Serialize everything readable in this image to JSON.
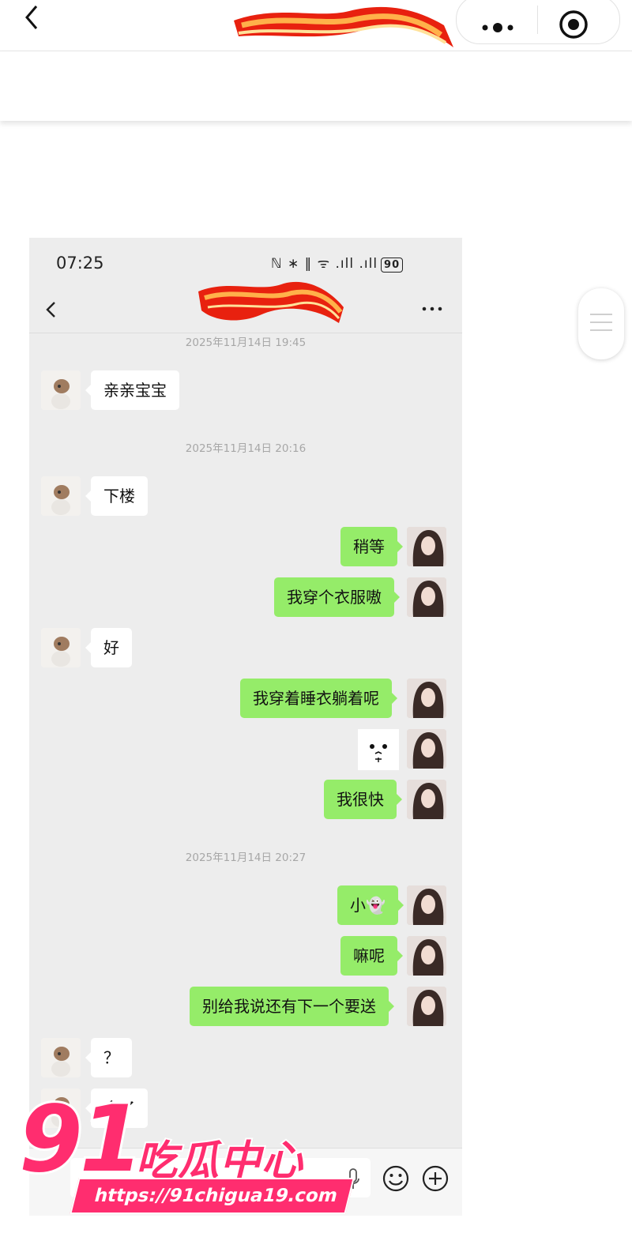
{
  "outer": {
    "subtitle": ""
  },
  "phone_status": {
    "time": "07:25",
    "icons": "ℕ ∗ ‖ ᯤ .ıll .ıll",
    "battery": "90"
  },
  "chat": {
    "messages": [
      {
        "type": "time",
        "text": "2025年11月14日 19:45"
      },
      {
        "type": "text",
        "side": "left",
        "text": "亲亲宝宝"
      },
      {
        "type": "time",
        "text": "2025年11月14日 20:16"
      },
      {
        "type": "text",
        "side": "left",
        "text": "下楼"
      },
      {
        "type": "text",
        "side": "right",
        "text": "稍等"
      },
      {
        "type": "text",
        "side": "right",
        "text": "我穿个衣服嗷"
      },
      {
        "type": "text",
        "side": "left",
        "text": "好"
      },
      {
        "type": "text",
        "side": "right",
        "text": "我穿着睡衣躺着呢"
      },
      {
        "type": "sticker",
        "side": "right",
        "icon": "sticker-face-icon"
      },
      {
        "type": "text",
        "side": "right",
        "text": "我很快"
      },
      {
        "type": "time",
        "text": "2025年11月14日 20:27"
      },
      {
        "type": "text",
        "side": "right",
        "text": "小👻"
      },
      {
        "type": "text",
        "side": "right",
        "text": "嘛呢"
      },
      {
        "type": "text",
        "side": "right",
        "text": "别给我说还有下一个要送"
      },
      {
        "type": "text",
        "side": "left",
        "text": "？"
      },
      {
        "type": "text",
        "side": "left",
        "text": "舍了"
      }
    ]
  },
  "watermark": {
    "number": "91",
    "name": "吃瓜中心",
    "url": "https://91chigua19.com"
  },
  "colors": {
    "bubble_right": "#95ec69",
    "bubble_left": "#ffffff",
    "chat_bg": "#ededed",
    "watermark": "#ff2d6f"
  }
}
